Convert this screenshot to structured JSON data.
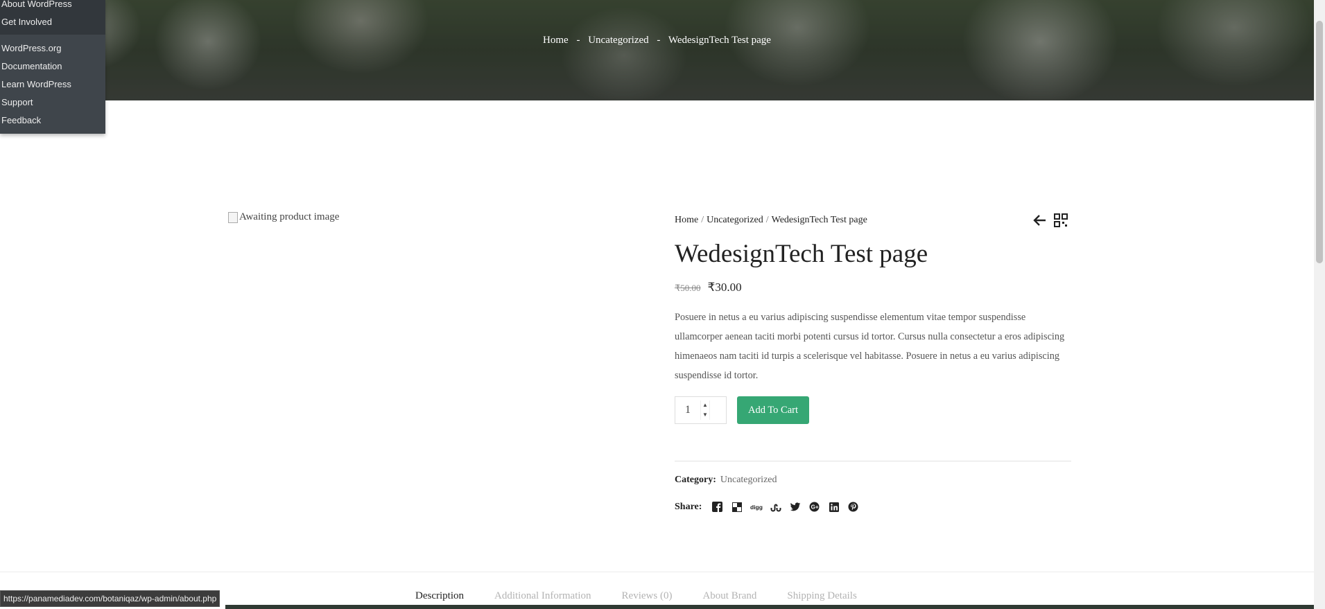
{
  "hero": {
    "breadcrumb": [
      "Home",
      "Uncategorized",
      "WedesignTech Test page"
    ],
    "separator": "-"
  },
  "admin_menu": {
    "items": [
      "About WordPress",
      "Get Involved",
      "WordPress.org",
      "Documentation",
      "Learn WordPress",
      "Support",
      "Feedback"
    ]
  },
  "product": {
    "image_alt": "Awaiting product image",
    "breadcrumb": [
      "Home",
      "Uncategorized",
      "WedesignTech Test page"
    ],
    "breadcrumb_separator": "/",
    "title": "WedesignTech Test page",
    "old_price": "₹50.00",
    "price": "₹30.00",
    "description": "Posuere in netus a eu varius adipiscing suspendisse elementum vitae tempor suspendisse ullamcorper aenean taciti morbi potenti cursus id tortor. Cursus nulla consectetur a eros adipiscing himenaeos nam taciti id turpis a scelerisque vel habitasse. Posuere in netus a eu varius adipiscing suspendisse id tortor.",
    "quantity": "1",
    "add_to_cart": "Add To Cart",
    "category_label": "Category:",
    "category_value": "Uncategorized",
    "share_label": "Share:",
    "share_icons": [
      "facebook-icon",
      "delicious-icon",
      "digg-icon",
      "stumbleupon-icon",
      "twitter-icon",
      "google-plus-icon",
      "linkedin-icon",
      "pinterest-icon"
    ]
  },
  "tabs": [
    "Description",
    "Additional Information",
    "Reviews (0)",
    "About Brand",
    "Shipping Details"
  ],
  "active_tab": "Description",
  "status_url": "https://panamediadev.com/botaniqaz/wp-admin/about.php",
  "colors": {
    "accent": "#36a774",
    "admin_menu_bg": "#32373c"
  }
}
